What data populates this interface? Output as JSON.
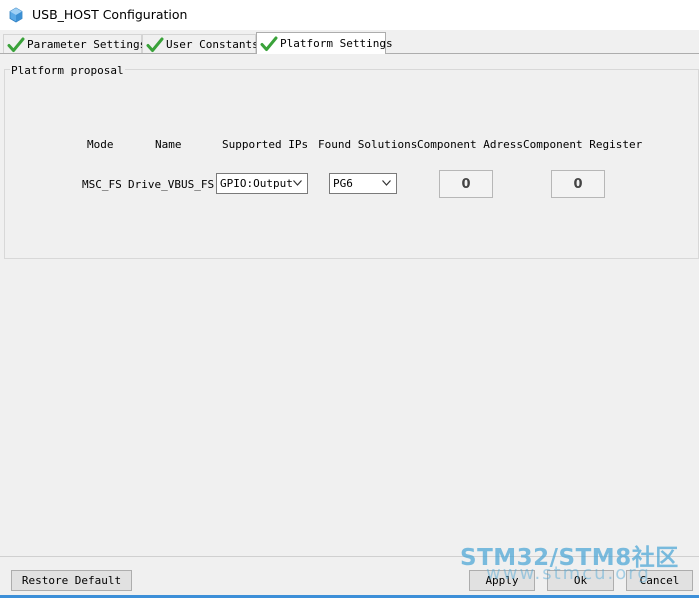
{
  "window": {
    "title": "USB_HOST Configuration",
    "icon": "cube-icon"
  },
  "tabs": [
    {
      "label": "Parameter Settings",
      "icon": "green-check-icon",
      "active": false
    },
    {
      "label": "User Constants",
      "icon": "green-check-icon",
      "active": false
    },
    {
      "label": "Platform Settings",
      "icon": "green-check-icon",
      "active": true
    }
  ],
  "platform": {
    "group_label": "Platform proposal",
    "headers": {
      "mode": "Mode",
      "name": "Name",
      "supported_ips": "Supported IPs",
      "found_solutions": "Found Solutions",
      "component_address": "Component Adress",
      "component_register": "Component Register"
    },
    "row": {
      "mode": "MSC_FS",
      "name": "Drive_VBUS_FS",
      "supported_ip": "GPIO:Output",
      "found_solution": "PG6",
      "component_address": "0",
      "component_register": "0"
    }
  },
  "footer": {
    "restore_default": "Restore Default",
    "apply": "Apply",
    "ok": "Ok",
    "cancel": "Cancel"
  },
  "watermark": {
    "main": "STM32/STM8社区",
    "sub": "www.stmcu.org"
  },
  "colors": {
    "check": "#3aa23a",
    "accent": "#3c8fd8",
    "watermark": "#4aa6d6"
  }
}
